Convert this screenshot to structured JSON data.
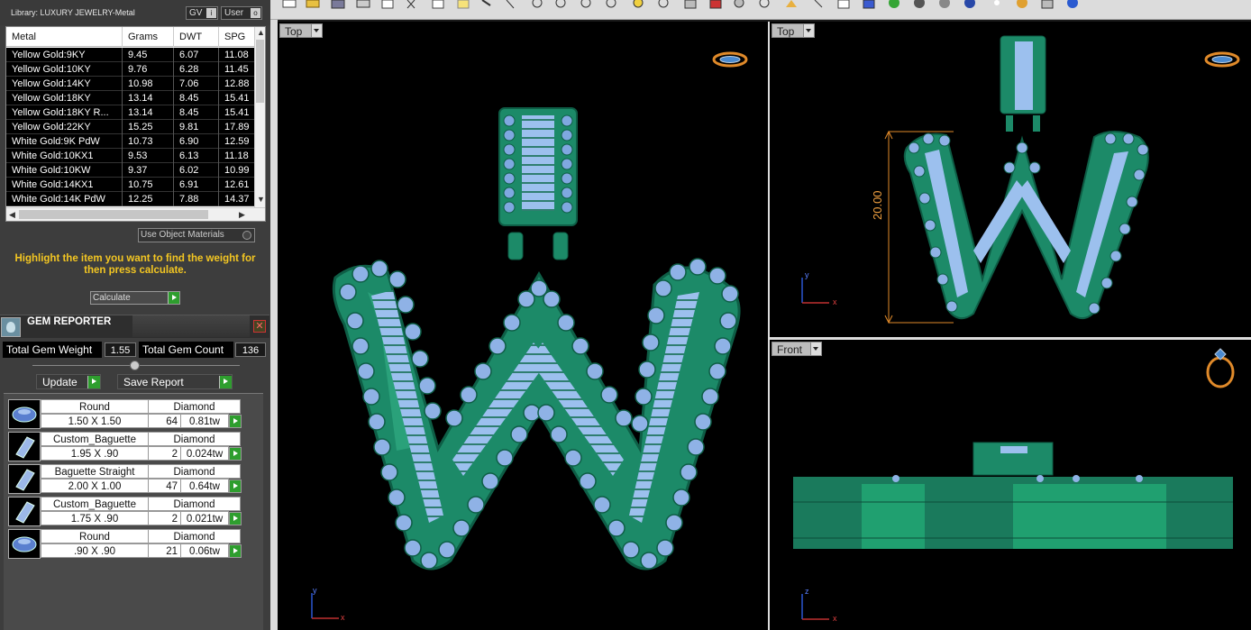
{
  "library": {
    "label": "Library: LUXURY JEWELRY-Metal",
    "gv": "GV",
    "user": "User"
  },
  "metal_table": {
    "headers": [
      "Metal",
      "Grams",
      "DWT",
      "SPG"
    ],
    "rows": [
      [
        "Yellow Gold:9KY",
        "9.45",
        "6.07",
        "11.08"
      ],
      [
        "Yellow Gold:10KY",
        "9.76",
        "6.28",
        "11.45"
      ],
      [
        "Yellow Gold:14KY",
        "10.98",
        "7.06",
        "12.88"
      ],
      [
        "Yellow Gold:18KY",
        "13.14",
        "8.45",
        "15.41"
      ],
      [
        "Yellow Gold:18KY R...",
        "13.14",
        "8.45",
        "15.41"
      ],
      [
        "Yellow Gold:22KY",
        "15.25",
        "9.81",
        "17.89"
      ],
      [
        "White Gold:9K PdW",
        "10.73",
        "6.90",
        "12.59"
      ],
      [
        "White Gold:10KX1",
        "9.53",
        "6.13",
        "11.18"
      ],
      [
        "White Gold:10KW",
        "9.37",
        "6.02",
        "10.99"
      ],
      [
        "White Gold:14KX1",
        "10.75",
        "6.91",
        "12.61"
      ],
      [
        "White Gold:14K PdW",
        "12.25",
        "7.88",
        "14.37"
      ]
    ]
  },
  "use_object_materials": "Use Object Materials",
  "hint": "Highlight the item you want to find the weight for then press calculate.",
  "calculate": "Calculate",
  "gem_reporter": {
    "title": "GEM REPORTER",
    "total_weight_label": "Total Gem Weight",
    "total_weight": "1.55",
    "total_count_label": "Total Gem Count",
    "total_count": "136",
    "update": "Update",
    "save_report": "Save Report",
    "gems": [
      {
        "shape": "Round",
        "type": "Diamond",
        "size": "1.50 X 1.50",
        "count": "64",
        "weight": "0.81tw",
        "icon": "round-gem-icon"
      },
      {
        "shape": "Custom_Baguette",
        "type": "Diamond",
        "size": "1.95 X .90",
        "count": "2",
        "weight": "0.024tw",
        "icon": "baguette-gem-icon"
      },
      {
        "shape": "Baguette Straight",
        "type": "Diamond",
        "size": "2.00 X 1.00",
        "count": "47",
        "weight": "0.64tw",
        "icon": "baguette-gem-icon"
      },
      {
        "shape": "Custom_Baguette",
        "type": "Diamond",
        "size": "1.75 X .90",
        "count": "2",
        "weight": "0.021tw",
        "icon": "baguette-gem-icon"
      },
      {
        "shape": "Round",
        "type": "Diamond",
        "size": ".90 X .90",
        "count": "21",
        "weight": "0.06tw",
        "icon": "round-gem-icon"
      }
    ]
  },
  "viewports": {
    "main_tab": "Top",
    "top_right_tab": "Top",
    "front_tab": "Front",
    "dimension": "20.00",
    "axis_y": "y",
    "axis_x": "x",
    "axis_z": "z"
  },
  "colors": {
    "accent_hint": "#f3c622",
    "go_button": "#2e9e2e",
    "metal": "#1f8f69",
    "gems": "#8fb2e6"
  }
}
